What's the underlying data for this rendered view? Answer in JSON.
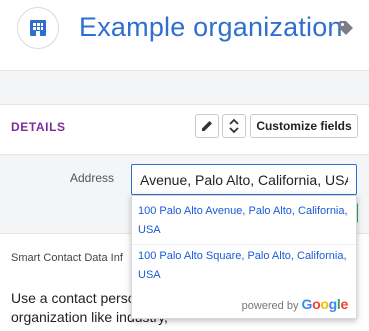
{
  "header": {
    "title": "Example organization",
    "avatar_icon": "building-icon",
    "tag_icon": "tag-icon"
  },
  "details": {
    "title": "DETAILS",
    "customize_label": "Customize fields",
    "edit_icon": "pencil-icon",
    "sort_icon": "up-down-icon"
  },
  "address": {
    "label": "Address",
    "value": "Avenue, Palo Alto, California, USA"
  },
  "autocomplete": {
    "suggestions": [
      "100 Palo Alto Avenue, Palo Alto, California, USA",
      "100 Palo Alto Square, Palo Alto, California, USA"
    ],
    "powered_by": "powered by",
    "google": "Google"
  },
  "smart_contact": {
    "title": "Smart Contact Data Inf",
    "paragraph": "Use a contact person additional info about their organization like industry,"
  },
  "colors": {
    "accent": "#2f6fd0",
    "details_purple": "#7b2f9a",
    "save_green": "#2fa84f"
  }
}
